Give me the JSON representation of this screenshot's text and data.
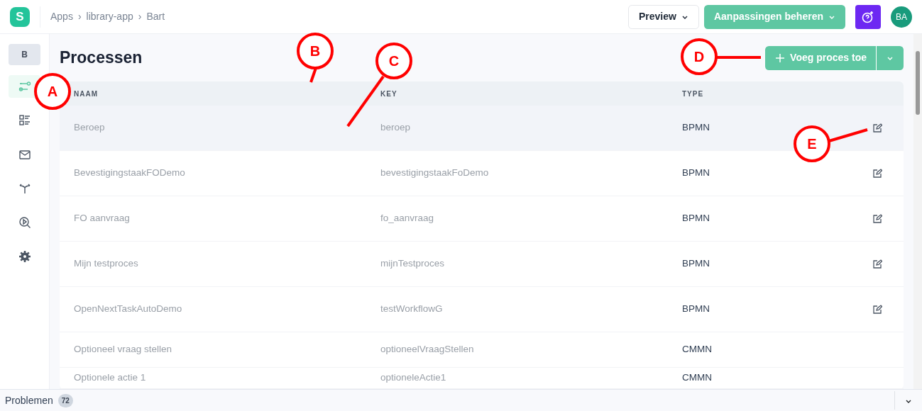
{
  "logo": "S",
  "breadcrumb": {
    "separator": "›",
    "items": [
      "Apps",
      "library-app",
      "Bart"
    ]
  },
  "topbar": {
    "preview_button": "Preview",
    "manage_button": "Aanpassingen beheren",
    "avatar": "BA"
  },
  "sidebar": {
    "badge": "B",
    "items": [
      {
        "kind": "sliders",
        "selected": true
      },
      {
        "kind": "list",
        "selected": false
      },
      {
        "kind": "mail",
        "selected": false
      },
      {
        "kind": "split",
        "selected": false
      },
      {
        "kind": "search",
        "selected": false
      },
      {
        "kind": "gear",
        "selected": false
      }
    ]
  },
  "page": {
    "title": "Processen",
    "add_button": "Voeg proces toe"
  },
  "table": {
    "columns": [
      "NAAM",
      "KEY",
      "TYPE"
    ],
    "rows": [
      {
        "name": "Beroep",
        "key": "beroep",
        "type": "BPMN",
        "editable": true,
        "hovered": true
      },
      {
        "name": "BevestigingstaakFODemo",
        "key": "bevestigingstaakFoDemo",
        "type": "BPMN",
        "editable": true,
        "hovered": false
      },
      {
        "name": "FO aanvraag",
        "key": "fo_aanvraag",
        "type": "BPMN",
        "editable": true,
        "hovered": false
      },
      {
        "name": "Mijn testproces",
        "key": "mijnTestproces",
        "type": "BPMN",
        "editable": true,
        "hovered": false
      },
      {
        "name": "OpenNextTaskAutoDemo",
        "key": "testWorkflowG",
        "type": "BPMN",
        "editable": true,
        "hovered": false
      },
      {
        "name": "Optioneel vraag stellen",
        "key": "optioneelVraagStellen",
        "type": "CMMN",
        "editable": false,
        "hovered": false
      },
      {
        "name": "Optionele actie 1",
        "key": "optioneleActie1",
        "type": "CMMN",
        "editable": false,
        "hovered": false
      }
    ]
  },
  "footer": {
    "label": "Problemen",
    "count": "72"
  },
  "callouts": [
    {
      "label": "A"
    },
    {
      "label": "B"
    },
    {
      "label": "C"
    },
    {
      "label": "D"
    },
    {
      "label": "E"
    }
  ]
}
